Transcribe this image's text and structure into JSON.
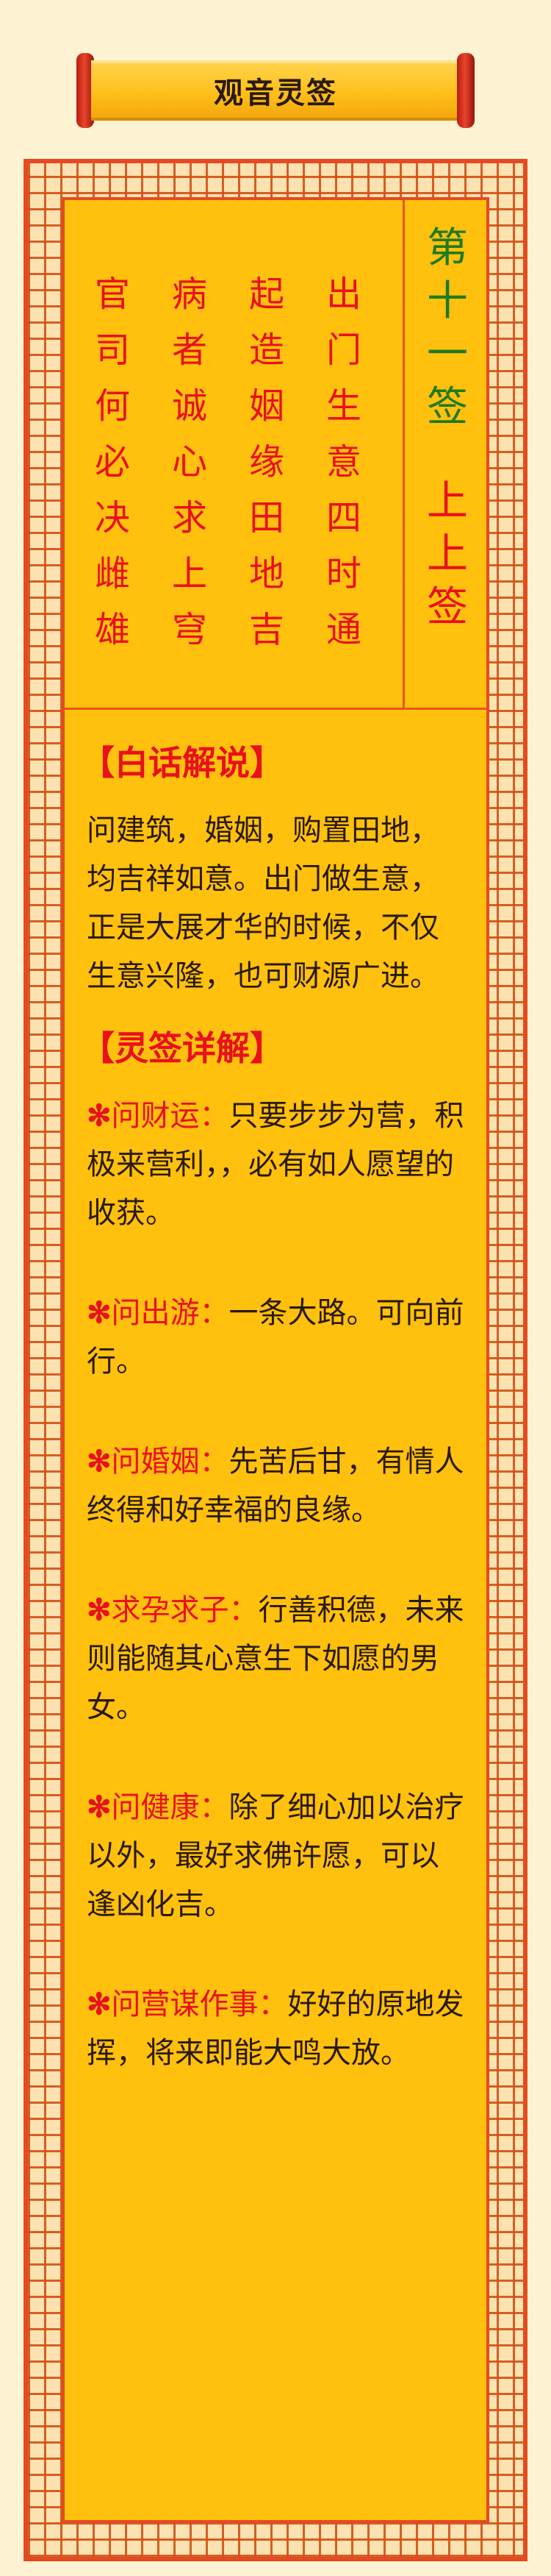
{
  "header": {
    "title": "观音灵签"
  },
  "poem": {
    "columns": [
      "出门生意四时通",
      "起造姻缘田地吉",
      "病者诚心求上穹",
      "官司何必决雌雄"
    ]
  },
  "sign": {
    "number": "第十一签",
    "rank": "上上签"
  },
  "plain": {
    "heading": "【白话解说】",
    "text": "问建筑，婚姻，购置田地，均吉祥如意。出门做生意，正是大展才华的时候，不仅生意兴隆，也可财源广进。"
  },
  "details": {
    "heading": "【灵签详解】",
    "star": "✻",
    "items": [
      {
        "label": "问财运：",
        "text": "只要步步为营，积极来营利，，必有如人愿望的收获。"
      },
      {
        "label": "问出游：",
        "text": "一条大路。可向前行。"
      },
      {
        "label": "问婚姻：",
        "text": "先苦后甘，有情人终得和好幸福的良缘。"
      },
      {
        "label": "求孕求子：",
        "text": "行善积德，未来则能随其心意生下如愿的男女。"
      },
      {
        "label": "问健康：",
        "text": "除了细心加以治疗以外，最好求佛许愿，可以逢凶化吉。"
      },
      {
        "label": "问营谋作事：",
        "text": "好好的原地发挥，将来即能大鸣大放。"
      }
    ]
  },
  "colors": {
    "accent_red": "#e8111c",
    "panel_yellow": "#ffc00e",
    "frame_orange": "#e34b22",
    "sign_green": "#1f7a1f",
    "background": "#fdf3d3"
  }
}
